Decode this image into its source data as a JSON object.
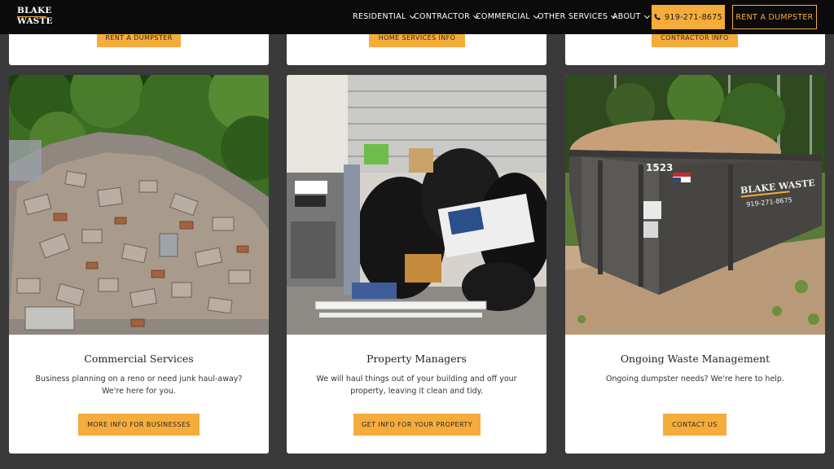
{
  "header": {
    "logo_line1": "BLAKE",
    "logo_line2": "WASTE",
    "nav": [
      {
        "label": "RESIDENTIAL"
      },
      {
        "label": "CONTRACTOR"
      },
      {
        "label": "COMMERCIAL"
      },
      {
        "label": "OTHER SERVICES"
      },
      {
        "label": "ABOUT"
      }
    ],
    "phone_label": "919-271-8675",
    "rent_label": "RENT A DUMPSTER"
  },
  "top_cards": [
    {
      "button": "RENT A DUMPSTER"
    },
    {
      "button": "HOME SERVICES INFO"
    },
    {
      "button": "CONTRACTOR INFO"
    }
  ],
  "cards": [
    {
      "title": "Commercial Services",
      "text": "Business planning on a reno or need junk haul-away? We're here for you.",
      "button": "MORE INFO FOR BUSINESSES"
    },
    {
      "title": "Property Managers",
      "text": "We will haul things out of your building and off your property, leaving it clean and tidy.",
      "button": "GET INFO FOR YOUR PROPERTY"
    },
    {
      "title": "Ongoing Waste Management",
      "text": "Ongoing dumpster needs? We're here to help.",
      "button": "CONTACT US"
    }
  ],
  "dumpster_photo": {
    "number": "1523",
    "brand_line1": "BLAKE WASTE",
    "brand_line2": "919-271-8675"
  },
  "colors": {
    "accent": "#f5ac3a",
    "header_bg": "#0b0b0b",
    "page_bg": "#3a3a3a"
  }
}
